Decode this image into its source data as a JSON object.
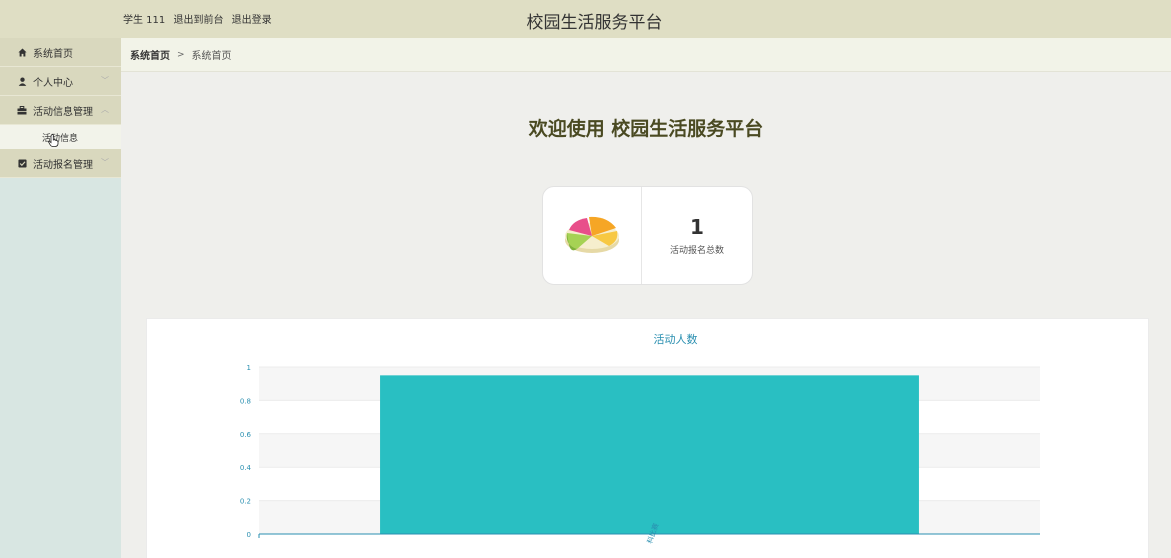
{
  "header": {
    "user_name": "学生 111",
    "back_to_front": "退出到前台",
    "logout": "退出登录",
    "site_title": "校园生活服务平台"
  },
  "sidebar": {
    "items": [
      {
        "label": "系统首页",
        "icon": "home-icon"
      },
      {
        "label": "个人中心",
        "icon": "user-icon"
      },
      {
        "label": "活动信息管理",
        "icon": "briefcase-icon",
        "sub": [
          {
            "label": "活动信息"
          }
        ]
      },
      {
        "label": "活动报名管理",
        "icon": "checkbox-icon"
      }
    ]
  },
  "breadcrumb": {
    "home": "系统首页",
    "separator": ">",
    "current": "系统首页"
  },
  "main": {
    "welcome": "欢迎使用 校园生活服务平台",
    "stat": {
      "value": "1",
      "label": "活动报名总数"
    }
  },
  "chart_data": {
    "type": "bar",
    "title": "活动人数",
    "categories": [
      "科比赛"
    ],
    "values": [
      0.95
    ],
    "ylim": [
      0,
      1
    ],
    "yticks": [
      0,
      0.2,
      0.4,
      0.6,
      0.8,
      1
    ],
    "color": "#29bfc2",
    "grid": true
  },
  "colors": {
    "topbar": "#dfdec4",
    "sidebar_item": "#d9d8be",
    "sidebar_bg": "#d8e6e2",
    "accent": "#29bfc2",
    "title_text": "#4a4a22"
  }
}
